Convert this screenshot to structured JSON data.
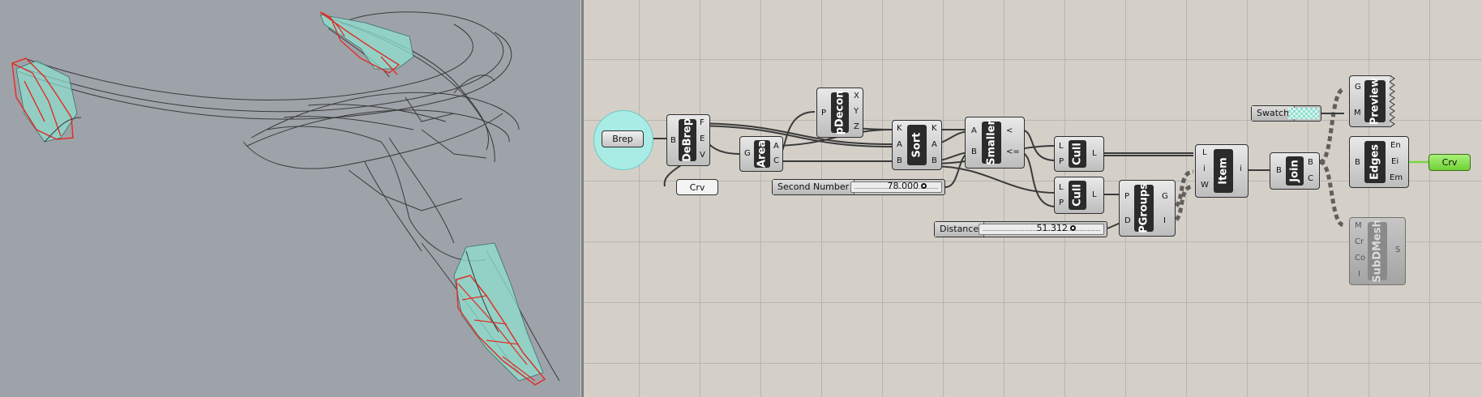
{
  "viewport": {
    "name": "rhino-viewport"
  },
  "components": {
    "brep": {
      "label": "Brep"
    },
    "crv_param": {
      "label": "Crv"
    },
    "debrep": {
      "nick": "DeBrep",
      "inputs": [
        "B"
      ],
      "outputs": [
        "F",
        "E",
        "V"
      ]
    },
    "area": {
      "nick": "Area",
      "inputs": [
        "G"
      ],
      "outputs": [
        "A",
        "C"
      ]
    },
    "pdecon": {
      "nick": "pDecon",
      "inputs": [
        "P"
      ],
      "outputs": [
        "X",
        "Y",
        "Z"
      ]
    },
    "sort": {
      "nick": "Sort",
      "inputs": [
        "K",
        "A",
        "B"
      ],
      "outputs": [
        "K",
        "A",
        "B"
      ]
    },
    "smaller": {
      "nick": "Smaller",
      "inputs": [
        "A",
        "B"
      ],
      "outputs": [
        "<",
        "<="
      ]
    },
    "cull1": {
      "nick": "Cull",
      "inputs": [
        "L",
        "P"
      ],
      "outputs": [
        "L"
      ]
    },
    "cull2": {
      "nick": "Cull",
      "inputs": [
        "L",
        "P"
      ],
      "outputs": [
        "L"
      ]
    },
    "pgroups": {
      "nick": "PGroups",
      "inputs": [
        "P",
        "D"
      ],
      "outputs": [
        "G",
        "I"
      ]
    },
    "item": {
      "nick": "Item",
      "inputs": [
        "L",
        "i",
        "W"
      ],
      "outputs": [
        "i"
      ]
    },
    "join": {
      "nick": "Join",
      "inputs": [
        "B"
      ],
      "outputs": [
        "B",
        "C"
      ]
    },
    "preview": {
      "nick": "Preview",
      "inputs": [
        "G",
        "M"
      ]
    },
    "edges": {
      "nick": "Edges",
      "inputs": [
        "B"
      ],
      "outputs": [
        "En",
        "Ei",
        "Em"
      ]
    },
    "crv_out": {
      "label": "Crv"
    },
    "subdmesh": {
      "nick": "SubDMesh",
      "inputs": [
        "M",
        "Cr",
        "Co",
        "I"
      ],
      "outputs": [
        "S"
      ]
    }
  },
  "sliders": {
    "second_number": {
      "label": "Second Number",
      "value": "78.000"
    },
    "distance": {
      "label": "Distance",
      "value": "51.312"
    }
  },
  "swatch": {
    "label": "Swatch",
    "color": "#8fe0d0"
  },
  "colors": {
    "canvas": "#d4d0c8",
    "viewport": "#9ea3a9",
    "selection": "#a9ece6",
    "highlight_edges": "#e0302a",
    "preview_fill": "#8fe0d0",
    "param_green": "#7ad63e"
  }
}
